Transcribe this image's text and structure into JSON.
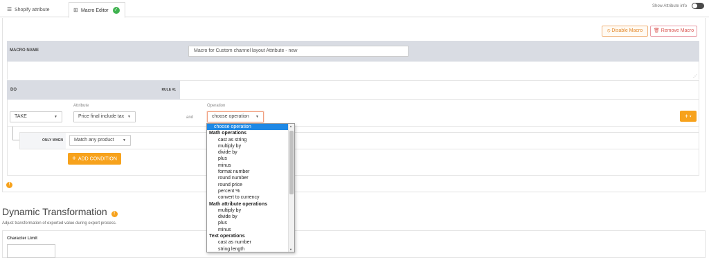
{
  "tabs": {
    "shopify_attribute": "Shopify attribute",
    "macro_editor": "Macro Editor"
  },
  "toggle": {
    "label": "Show Attribute info"
  },
  "actions": {
    "disable_macro": "Disable Macro",
    "remove_macro": "Remove Macro"
  },
  "macro": {
    "name_label": "MACRO NAME",
    "name_value": "Macro for Custom channel layout Attribute - new"
  },
  "rule": {
    "do_label": "DO",
    "rule_label": "RULE #1",
    "take_value": "TAKE",
    "attribute_label": "Attribute",
    "attribute_value": "Price final include tax",
    "and_label": "and",
    "operation_label": "Operation",
    "operation_value": "choose operation",
    "only_when_label": "ONLY WHEN",
    "condition_value": "Match any product",
    "add_condition": "ADD CONDITION",
    "plus_button": "+"
  },
  "operation_options": [
    {
      "label": "choose operation",
      "kind": "selected"
    },
    {
      "label": "Math operations",
      "kind": "group"
    },
    {
      "label": "cast as string",
      "kind": "child"
    },
    {
      "label": "multiply by",
      "kind": "child"
    },
    {
      "label": "divide by",
      "kind": "child"
    },
    {
      "label": "plus",
      "kind": "child"
    },
    {
      "label": "minus",
      "kind": "child"
    },
    {
      "label": "format number",
      "kind": "child"
    },
    {
      "label": "round number",
      "kind": "child"
    },
    {
      "label": "round price",
      "kind": "child"
    },
    {
      "label": "percent %",
      "kind": "child"
    },
    {
      "label": "convert to currency",
      "kind": "child"
    },
    {
      "label": "Math attribute operations",
      "kind": "group"
    },
    {
      "label": "multiply by",
      "kind": "child"
    },
    {
      "label": "divide by",
      "kind": "child"
    },
    {
      "label": "plus",
      "kind": "child"
    },
    {
      "label": "minus",
      "kind": "child"
    },
    {
      "label": "Text operations",
      "kind": "group"
    },
    {
      "label": "cast as number",
      "kind": "child"
    },
    {
      "label": "string length",
      "kind": "child"
    }
  ],
  "dynamic_transformation": {
    "title": "Dynamic Transformation",
    "subtitle": "Adjust transformation of exported value during export process.",
    "char_limit_label": "Character Limit"
  },
  "colors": {
    "accent_orange": "#f7a21c",
    "header_gray": "#d9dce3",
    "selected_blue": "#1e88e5",
    "success_green": "#3fb24f"
  }
}
